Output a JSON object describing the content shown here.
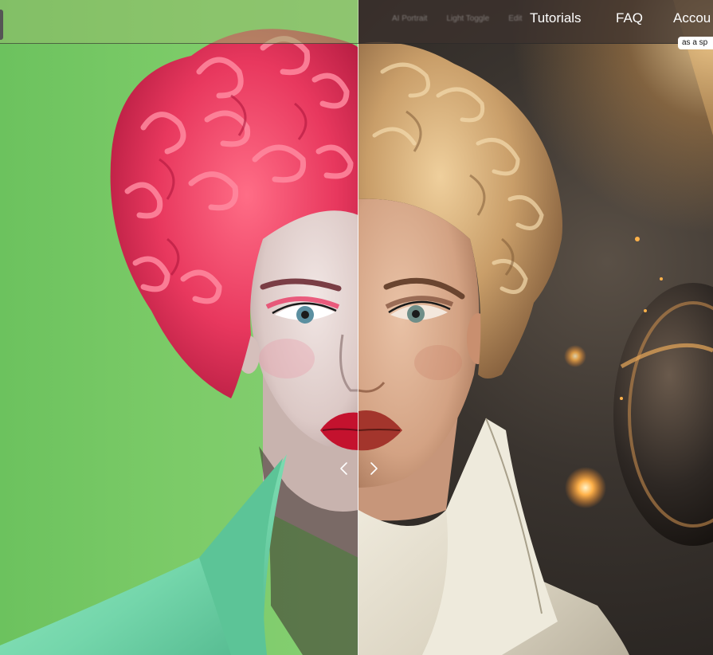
{
  "header": {
    "faint_links": [
      "AI Portrait",
      "Light Toggle",
      "Edit"
    ],
    "nav": [
      {
        "id": "tutorials",
        "label": "Tutorials"
      },
      {
        "id": "faq",
        "label": "FAQ"
      },
      {
        "id": "account",
        "label": "Accou"
      }
    ],
    "tooltip": "as a sp"
  },
  "comparison": {
    "left_image": "green-screen-portrait",
    "right_image": "cinematic-portrait",
    "split_percent": 50
  },
  "icons": {
    "prev": "chevron-left-icon",
    "next": "chevron-right-icon"
  },
  "colors": {
    "green_screen": "#7cc66a",
    "pink_hair": "#e8385e",
    "blonde_hair": "#c9a06a",
    "mint_jacket": "#7fd9b0",
    "white_jacket": "#e8e2d2",
    "divider": "#ffffff"
  }
}
